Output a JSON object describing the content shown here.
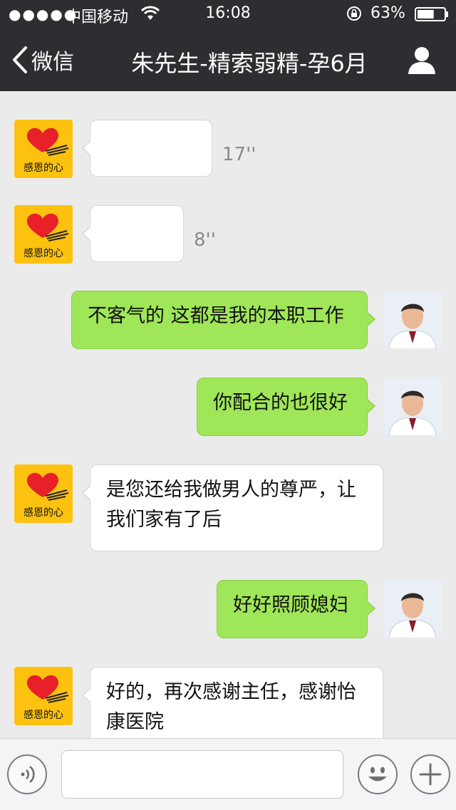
{
  "status_bar": {
    "signal_dots": "●●●●●",
    "carrier": "中国移动",
    "time": "16:08",
    "battery_percent": "63%",
    "battery_level": 0.63
  },
  "nav": {
    "back_label": "微信",
    "title": "朱先生-精索弱精-孕6月"
  },
  "messages": [
    {
      "side": "left",
      "type": "voice",
      "duration": "17''"
    },
    {
      "side": "left",
      "type": "voice",
      "duration": "8''"
    },
    {
      "side": "right",
      "type": "text",
      "text": "不客气的 这都是我的本职工作"
    },
    {
      "side": "right",
      "type": "text",
      "text": "你配合的也很好"
    },
    {
      "side": "left",
      "type": "text",
      "text": "是您还给我做男人的尊严，让\n我们家有了后"
    },
    {
      "side": "right",
      "type": "text",
      "text": "好好照顾媳妇"
    },
    {
      "side": "left",
      "type": "text",
      "text": "好的，再次感谢主任，感谢怡\n康医院"
    }
  ],
  "avatar_text": "感恩的心",
  "input": {
    "value": ""
  },
  "colors": {
    "header_bg": "#2e2e32",
    "chat_bg": "#ebebeb",
    "bubble_right": "#9fe658",
    "bubble_left": "#ffffff",
    "heart_avatar_bg": "#fcc20f"
  }
}
